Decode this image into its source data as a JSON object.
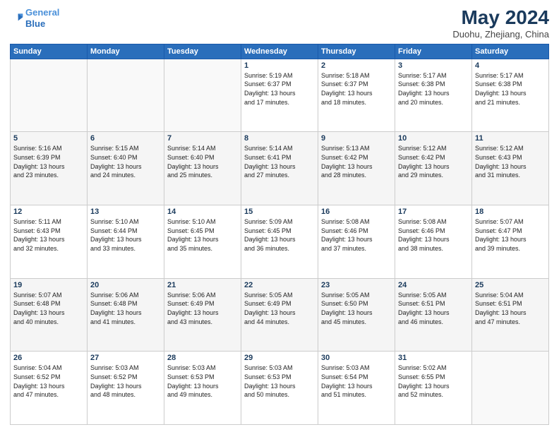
{
  "header": {
    "logo_line1": "General",
    "logo_line2": "Blue",
    "title": "May 2024",
    "subtitle": "Duohu, Zhejiang, China"
  },
  "weekdays": [
    "Sunday",
    "Monday",
    "Tuesday",
    "Wednesday",
    "Thursday",
    "Friday",
    "Saturday"
  ],
  "weeks": [
    [
      {
        "day": "",
        "info": ""
      },
      {
        "day": "",
        "info": ""
      },
      {
        "day": "",
        "info": ""
      },
      {
        "day": "1",
        "info": "Sunrise: 5:19 AM\nSunset: 6:37 PM\nDaylight: 13 hours\nand 17 minutes."
      },
      {
        "day": "2",
        "info": "Sunrise: 5:18 AM\nSunset: 6:37 PM\nDaylight: 13 hours\nand 18 minutes."
      },
      {
        "day": "3",
        "info": "Sunrise: 5:17 AM\nSunset: 6:38 PM\nDaylight: 13 hours\nand 20 minutes."
      },
      {
        "day": "4",
        "info": "Sunrise: 5:17 AM\nSunset: 6:38 PM\nDaylight: 13 hours\nand 21 minutes."
      }
    ],
    [
      {
        "day": "5",
        "info": "Sunrise: 5:16 AM\nSunset: 6:39 PM\nDaylight: 13 hours\nand 23 minutes."
      },
      {
        "day": "6",
        "info": "Sunrise: 5:15 AM\nSunset: 6:40 PM\nDaylight: 13 hours\nand 24 minutes."
      },
      {
        "day": "7",
        "info": "Sunrise: 5:14 AM\nSunset: 6:40 PM\nDaylight: 13 hours\nand 25 minutes."
      },
      {
        "day": "8",
        "info": "Sunrise: 5:14 AM\nSunset: 6:41 PM\nDaylight: 13 hours\nand 27 minutes."
      },
      {
        "day": "9",
        "info": "Sunrise: 5:13 AM\nSunset: 6:42 PM\nDaylight: 13 hours\nand 28 minutes."
      },
      {
        "day": "10",
        "info": "Sunrise: 5:12 AM\nSunset: 6:42 PM\nDaylight: 13 hours\nand 29 minutes."
      },
      {
        "day": "11",
        "info": "Sunrise: 5:12 AM\nSunset: 6:43 PM\nDaylight: 13 hours\nand 31 minutes."
      }
    ],
    [
      {
        "day": "12",
        "info": "Sunrise: 5:11 AM\nSunset: 6:43 PM\nDaylight: 13 hours\nand 32 minutes."
      },
      {
        "day": "13",
        "info": "Sunrise: 5:10 AM\nSunset: 6:44 PM\nDaylight: 13 hours\nand 33 minutes."
      },
      {
        "day": "14",
        "info": "Sunrise: 5:10 AM\nSunset: 6:45 PM\nDaylight: 13 hours\nand 35 minutes."
      },
      {
        "day": "15",
        "info": "Sunrise: 5:09 AM\nSunset: 6:45 PM\nDaylight: 13 hours\nand 36 minutes."
      },
      {
        "day": "16",
        "info": "Sunrise: 5:08 AM\nSunset: 6:46 PM\nDaylight: 13 hours\nand 37 minutes."
      },
      {
        "day": "17",
        "info": "Sunrise: 5:08 AM\nSunset: 6:46 PM\nDaylight: 13 hours\nand 38 minutes."
      },
      {
        "day": "18",
        "info": "Sunrise: 5:07 AM\nSunset: 6:47 PM\nDaylight: 13 hours\nand 39 minutes."
      }
    ],
    [
      {
        "day": "19",
        "info": "Sunrise: 5:07 AM\nSunset: 6:48 PM\nDaylight: 13 hours\nand 40 minutes."
      },
      {
        "day": "20",
        "info": "Sunrise: 5:06 AM\nSunset: 6:48 PM\nDaylight: 13 hours\nand 41 minutes."
      },
      {
        "day": "21",
        "info": "Sunrise: 5:06 AM\nSunset: 6:49 PM\nDaylight: 13 hours\nand 43 minutes."
      },
      {
        "day": "22",
        "info": "Sunrise: 5:05 AM\nSunset: 6:49 PM\nDaylight: 13 hours\nand 44 minutes."
      },
      {
        "day": "23",
        "info": "Sunrise: 5:05 AM\nSunset: 6:50 PM\nDaylight: 13 hours\nand 45 minutes."
      },
      {
        "day": "24",
        "info": "Sunrise: 5:05 AM\nSunset: 6:51 PM\nDaylight: 13 hours\nand 46 minutes."
      },
      {
        "day": "25",
        "info": "Sunrise: 5:04 AM\nSunset: 6:51 PM\nDaylight: 13 hours\nand 47 minutes."
      }
    ],
    [
      {
        "day": "26",
        "info": "Sunrise: 5:04 AM\nSunset: 6:52 PM\nDaylight: 13 hours\nand 47 minutes."
      },
      {
        "day": "27",
        "info": "Sunrise: 5:03 AM\nSunset: 6:52 PM\nDaylight: 13 hours\nand 48 minutes."
      },
      {
        "day": "28",
        "info": "Sunrise: 5:03 AM\nSunset: 6:53 PM\nDaylight: 13 hours\nand 49 minutes."
      },
      {
        "day": "29",
        "info": "Sunrise: 5:03 AM\nSunset: 6:53 PM\nDaylight: 13 hours\nand 50 minutes."
      },
      {
        "day": "30",
        "info": "Sunrise: 5:03 AM\nSunset: 6:54 PM\nDaylight: 13 hours\nand 51 minutes."
      },
      {
        "day": "31",
        "info": "Sunrise: 5:02 AM\nSunset: 6:55 PM\nDaylight: 13 hours\nand 52 minutes."
      },
      {
        "day": "",
        "info": ""
      }
    ]
  ]
}
